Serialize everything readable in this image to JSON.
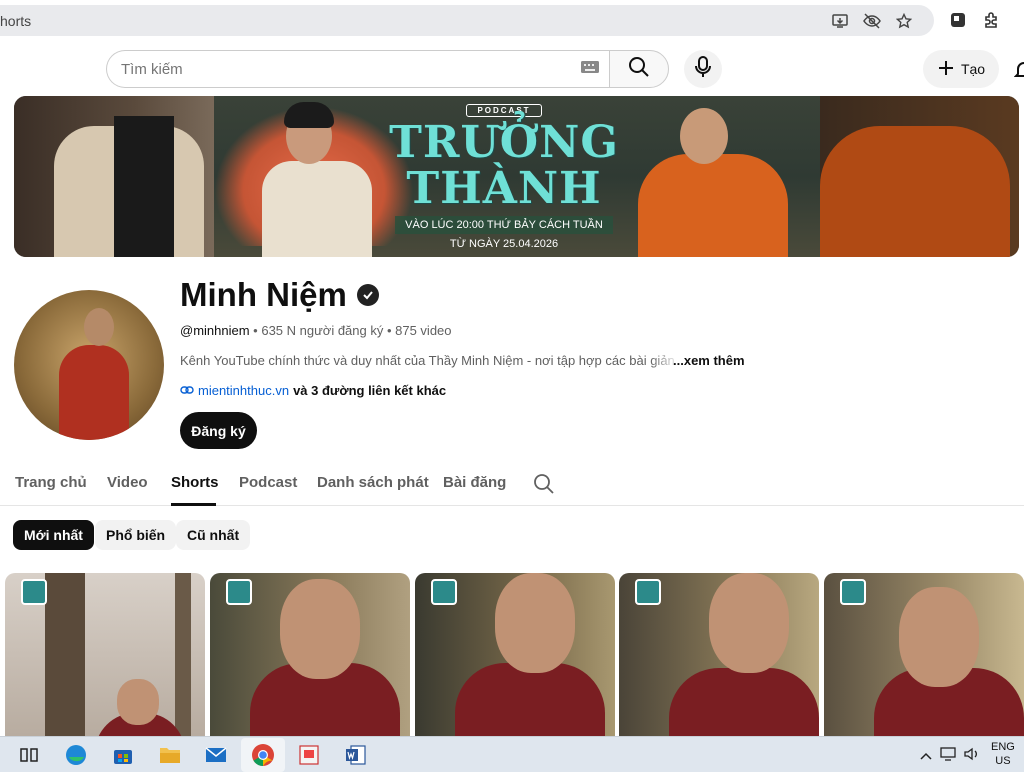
{
  "browser": {
    "url_text": "horts",
    "icons": [
      "install-icon",
      "eye-off-icon",
      "star-icon",
      "extension-puzzle-icon",
      "extensions-icon"
    ]
  },
  "header": {
    "search_placeholder": "Tìm kiếm",
    "create_label": "Tạo"
  },
  "banner": {
    "podcast_tag": "PODCAST",
    "title": "TRƯỞNG THÀNH",
    "time_line": "VÀO LÚC 20:00 THỨ BẢY CÁCH TUẦN",
    "date_line": "TỪ NGÀY 25.04.2026"
  },
  "channel": {
    "name": "Minh Niệm",
    "handle": "@minhniem",
    "meta": " • 635 N người đăng ký • 875 video",
    "description": "Kênh YouTube chính thức và duy nhất của Thầy Minh Niệm - nơi tập hợp các bài giản",
    "more_label": "...xem thêm",
    "link_url": "mientinhthuc.vn",
    "link_rest": " và 3 đường liên kết khác",
    "subscribe_label": "Đăng ký"
  },
  "tabs": [
    {
      "label": "Trang chủ",
      "active": false
    },
    {
      "label": "Video",
      "active": false
    },
    {
      "label": "Shorts",
      "active": true
    },
    {
      "label": "Podcast",
      "active": false
    },
    {
      "label": "Danh sách phát",
      "active": false
    },
    {
      "label": "Bài đăng",
      "active": false
    }
  ],
  "chips": [
    {
      "label": "Mới nhất",
      "active": true
    },
    {
      "label": "Phổ biến",
      "active": false
    },
    {
      "label": "Cũ nhất",
      "active": false
    }
  ],
  "taskbar": {
    "lang_line1": "ENG",
    "lang_line2": "US"
  },
  "colors": {
    "accent": "#0f0f0f",
    "link": "#065fd4",
    "banner_title": "#6fe0d6",
    "robe": "#7a1e22"
  }
}
